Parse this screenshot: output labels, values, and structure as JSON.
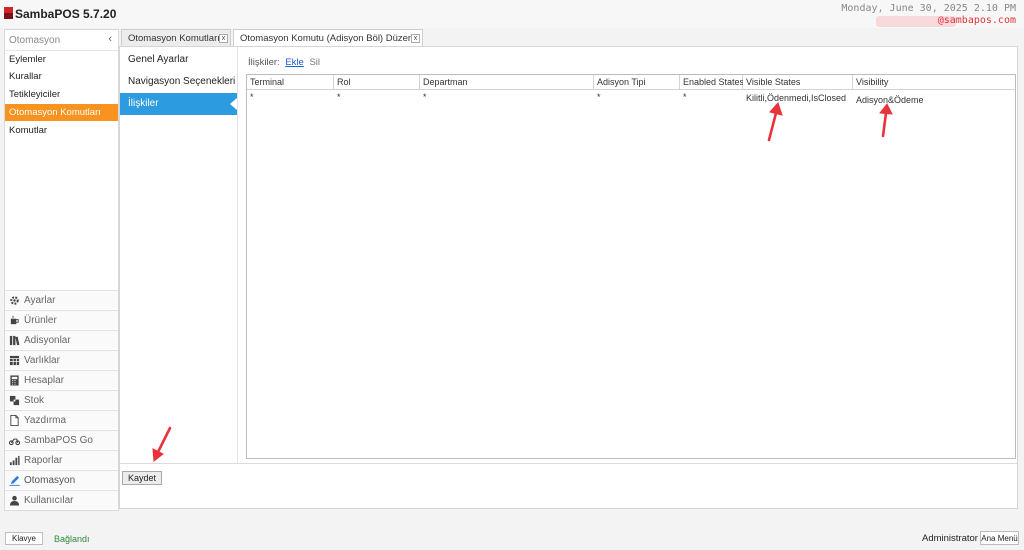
{
  "app": {
    "title": "SambaPOS 5.7.20",
    "clock": "Monday, June 30, 2025 2.10 PM",
    "brand": "@sambapos.com"
  },
  "sidebar": {
    "header": "Otomasyon",
    "collapse_glyph": "‹",
    "items": [
      {
        "label": "Eylemler"
      },
      {
        "label": "Kurallar"
      },
      {
        "label": "Tetikleyiciler"
      },
      {
        "label": "Otomasyon Komutları"
      },
      {
        "label": "Komutlar"
      }
    ],
    "modules": [
      {
        "label": "Ayarlar",
        "icon": "gear-icon"
      },
      {
        "label": "Ürünler",
        "icon": "coffee-icon"
      },
      {
        "label": "Adisyonlar",
        "icon": "books-icon"
      },
      {
        "label": "Varlıklar",
        "icon": "table-icon"
      },
      {
        "label": "Hesaplar",
        "icon": "calculator-icon"
      },
      {
        "label": "Stok",
        "icon": "stock-icon"
      },
      {
        "label": "Yazdırma",
        "icon": "document-icon"
      },
      {
        "label": "SambaPOS Go",
        "icon": "motorbike-icon"
      },
      {
        "label": "Raporlar",
        "icon": "bar-chart-icon"
      },
      {
        "label": "Otomasyon",
        "icon": "pen-icon"
      },
      {
        "label": "Kullanıcılar",
        "icon": "user-icon"
      }
    ]
  },
  "tabs": [
    {
      "label": "Otomasyon Komutları",
      "close": "x"
    },
    {
      "label": "Otomasyon Komutu (Adisyon Böl) Düzenle",
      "close": "x"
    }
  ],
  "editor": {
    "subnav": [
      {
        "label": "Genel Ayarlar"
      },
      {
        "label": "Navigasyon Seçenekleri"
      },
      {
        "label": "İlişkiler"
      }
    ],
    "relations_label": "İlişkiler:",
    "add_link": "Ekle",
    "delete_link": "Sil",
    "grid": {
      "columns": [
        "Terminal",
        "Rol",
        "Departman",
        "Adisyon Tipi",
        "Enabled States",
        "Visible States",
        "Visibility"
      ],
      "rows": [
        [
          "*",
          "*",
          "*",
          "*",
          "*",
          "Kilitli,Ödenmedi,IsClosed",
          "Adisyon&Ödeme"
        ]
      ]
    },
    "save_label": "Kaydet"
  },
  "status": {
    "keyboard": "Klavye",
    "connection": "Bağlandı",
    "user": "Administrator",
    "main_menu": "Ana Menü"
  },
  "colors": {
    "accent_orange": "#f7931e",
    "accent_blue": "#2d9be0",
    "annotation_red": "#e8333a",
    "connected_green": "#2e8b3e"
  }
}
